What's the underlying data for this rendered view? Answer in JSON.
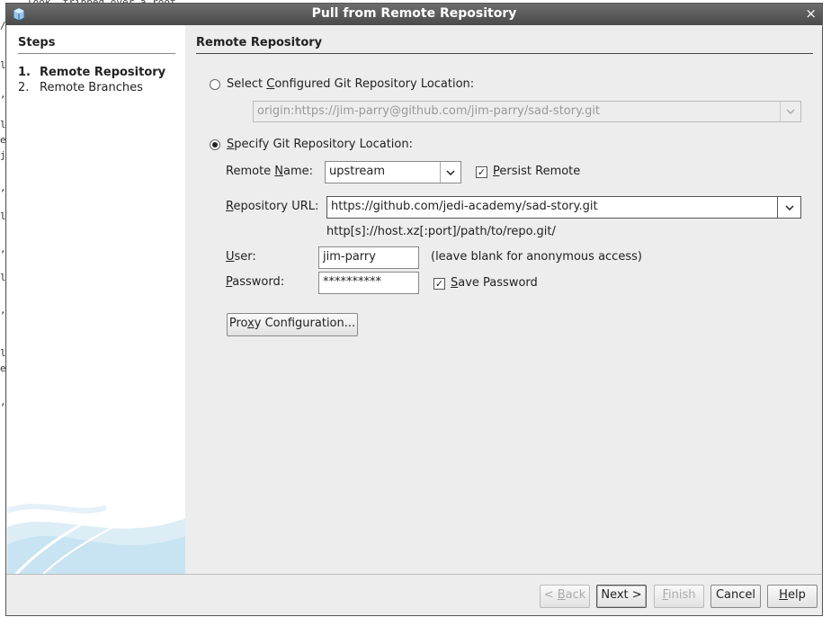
{
  "background": {
    "top_text": "look, tripped over a root",
    "edge_chars": [
      "/",
      "l",
      ",",
      "l",
      "e",
      "j",
      ",",
      "l",
      ",",
      "l",
      ",",
      "l",
      "e",
      ","
    ]
  },
  "window": {
    "title": "Pull from Remote Repository",
    "close_glyph": "×"
  },
  "steps": {
    "title": "Steps",
    "items": [
      {
        "num": "1.",
        "label": "Remote Repository"
      },
      {
        "num": "2.",
        "label": "Remote Branches"
      }
    ]
  },
  "section": {
    "title": "Remote Repository"
  },
  "configured": {
    "label_pre": "Select ",
    "label_mnemonic": "C",
    "label_post": "onfigured Git Repository Location:",
    "value": "origin:https://jim-parry@github.com/jim-parry/sad-story.git"
  },
  "specify": {
    "label_pre": "",
    "label_mnemonic": "S",
    "label_post": "pecify Git Repository Location:"
  },
  "remote_name": {
    "label_pre": "Remote ",
    "label_mnemonic": "N",
    "label_post": "ame:",
    "value": "upstream"
  },
  "persist_remote": {
    "label_pre": "",
    "label_mnemonic": "P",
    "label_post": "ersist Remote",
    "check": "✓"
  },
  "repository_url": {
    "label_pre": "",
    "label_mnemonic": "R",
    "label_post": "epository URL:",
    "value": "https://github.com/jedi-academy/sad-story.git",
    "hint": "http[s]://host.xz[:port]/path/to/repo.git/"
  },
  "user": {
    "label_pre": "",
    "label_mnemonic": "U",
    "label_post": "ser:",
    "value": "jim-parry",
    "hint": "(leave blank for anonymous access)"
  },
  "password": {
    "label_pre": "",
    "label_mnemonic": "P",
    "label_post": "assword:",
    "value": "**********"
  },
  "save_password": {
    "label_pre": "",
    "label_mnemonic": "S",
    "label_post": "ave Password",
    "check": "✓"
  },
  "proxy_button": {
    "label_pre": "Pro",
    "label_mnemonic": "x",
    "label_post": "y Configuration..."
  },
  "footer": {
    "back": {
      "pre": "< ",
      "mn": "B",
      "post": "ack"
    },
    "next": {
      "pre": "Next >",
      "mn": "",
      "post": ""
    },
    "finish": {
      "pre": "",
      "mn": "F",
      "post": "inish"
    },
    "cancel": {
      "pre": "Cancel",
      "mn": "",
      "post": ""
    },
    "help": {
      "pre": "",
      "mn": "H",
      "post": "elp"
    }
  },
  "icons": {
    "dropdown": "chevron-down-icon",
    "app": "netbeans-cube-icon"
  },
  "colors": {
    "titlebar": "#5a5a5a",
    "dialog_bg": "#ededed",
    "steps_bg": "#ffffff",
    "swirl": "#c8e4f2"
  }
}
